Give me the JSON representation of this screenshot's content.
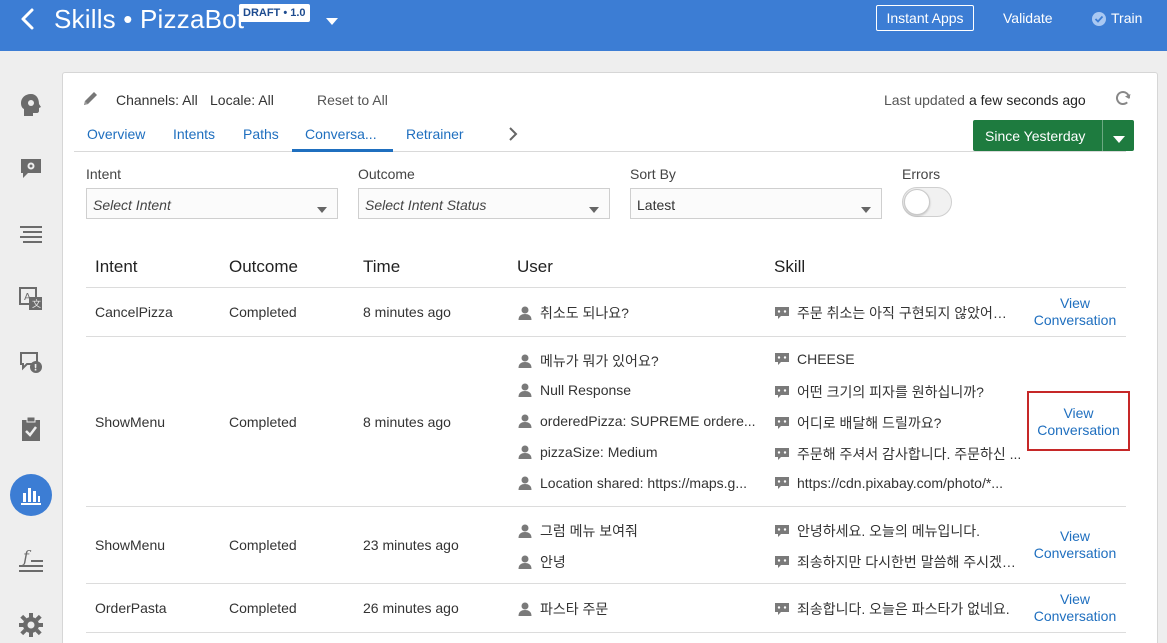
{
  "header": {
    "title": "Skills • PizzaBot",
    "badge": "DRAFT • 1.0",
    "instant_apps": "Instant Apps",
    "validate": "Validate",
    "train": "Train",
    "color": "#3c7dd4"
  },
  "rail": {
    "icons": [
      "bot-head-icon",
      "intents-icon",
      "entities-icon",
      "translate-icon",
      "qna-icon",
      "tasks-icon",
      "insights-icon",
      "functions-icon",
      "settings-icon"
    ],
    "active": "insights-icon"
  },
  "filter_bar": {
    "channels_label": "Channels:",
    "channels_value": "All",
    "locale_label": "Locale:",
    "locale_value": "All",
    "reset": "Reset to All",
    "last_updated_label": "Last updated",
    "last_updated_value": "a few seconds ago"
  },
  "tabs": [
    "Overview",
    "Intents",
    "Paths",
    "Conversa...",
    "Retrainer"
  ],
  "active_tab": "Conversa...",
  "since": "Since Yesterday",
  "filters": {
    "intent_label": "Intent",
    "intent_placeholder": "Select Intent",
    "outcome_label": "Outcome",
    "outcome_placeholder": "Select Intent Status",
    "sort_label": "Sort By",
    "sort_value": "Latest",
    "errors_label": "Errors",
    "errors_on": false
  },
  "table": {
    "headers": [
      "Intent",
      "Outcome",
      "Time",
      "User",
      "Skill"
    ],
    "view_label_1": "View",
    "view_label_2": "Conversation",
    "rows": [
      {
        "intent": "CancelPizza",
        "outcome": "Completed",
        "time": "8 minutes ago",
        "user": [
          "취소도 되나요?"
        ],
        "skill": [
          "주문 취소는 아직 구현되지 않았어요 ..."
        ]
      },
      {
        "intent": "ShowMenu",
        "outcome": "Completed",
        "time": "8 minutes ago",
        "user": [
          "메뉴가 뭐가 있어요?",
          "Null Response",
          "orderedPizza: SUPREME  ordere...",
          "pizzaSize: Medium",
          "Location shared: https://maps.g..."
        ],
        "skill": [
          "CHEESE",
          "어떤 크기의 피자를 원하십니까?",
          "어디로 배달해 드릴까요?",
          "주문해 주셔서 감사합니다. 주문하신 ...",
          "https://cdn.pixabay.com/photo/*..."
        ]
      },
      {
        "intent": "ShowMenu",
        "outcome": "Completed",
        "time": "23 minutes ago",
        "user": [
          "그럼 메뉴 보여줘",
          "안녕"
        ],
        "skill": [
          "안녕하세요. 오늘의 메뉴입니다.",
          "죄송하지만 다시한번 말씀해 주시겠어..."
        ]
      },
      {
        "intent": "OrderPasta",
        "outcome": "Completed",
        "time": "26 minutes ago",
        "user": [
          "파스타 주문"
        ],
        "skill": [
          "죄송합니다. 오늘은 파스타가 없네요."
        ]
      }
    ]
  }
}
